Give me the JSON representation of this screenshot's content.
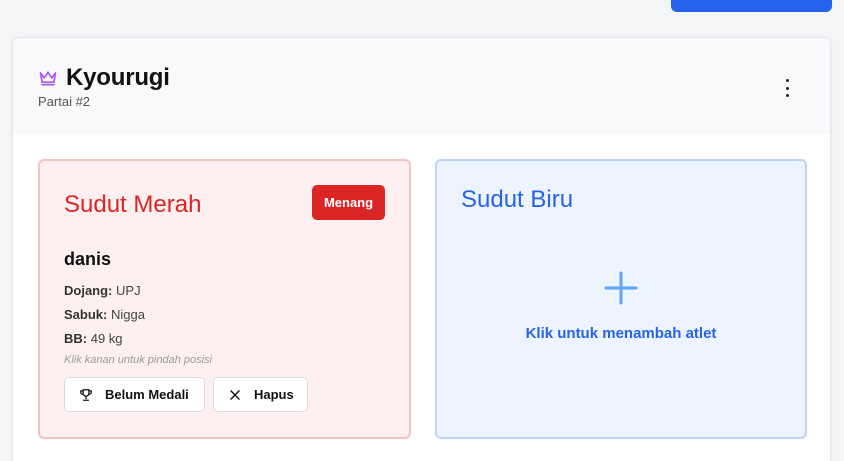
{
  "header": {
    "title": "Kyourugi",
    "subtitle": "Partai #2"
  },
  "red_corner": {
    "title": "Sudut Merah",
    "badge": "Menang",
    "athlete": {
      "name": "danis",
      "dojang_label": "Dojang:",
      "dojang": "UPJ",
      "sabuk_label": "Sabuk:",
      "sabuk": "Nigga",
      "bb_label": "BB:",
      "bb": "49 kg"
    },
    "hint": "Klik kanan untuk pindah posisi",
    "medal_button": "Belum Medali",
    "delete_button": "Hapus"
  },
  "blue_corner": {
    "title": "Sudut Biru",
    "add_text": "Klik untuk menambah atlet"
  },
  "colors": {
    "red": "#dc2626",
    "blue": "#2563eb",
    "crown": "#a855f7"
  },
  "icons": {
    "title": "crown-icon",
    "menu": "more-vertical-icon",
    "medal": "trophy-icon",
    "delete": "close-icon",
    "add": "plus-icon"
  }
}
